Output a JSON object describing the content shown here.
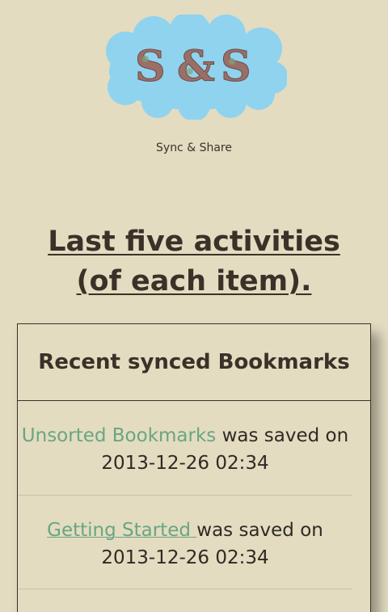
{
  "logo": {
    "text": "S&S",
    "colors": {
      "cloud": "#8fd3ef",
      "letters": "#9a6f68"
    }
  },
  "tagline": "Sync & Share",
  "heading": "Last five activities (of each item).",
  "panel": {
    "title": "Recent synced Bookmarks",
    "entries": [
      {
        "link": "Unsorted Bookmarks",
        "text": " was saved on",
        "date": "2013-12-26 02:34"
      },
      {
        "link": "Getting Started ",
        "text": "was saved on",
        "date": "2013-12-26 02:34"
      }
    ]
  },
  "colors": {
    "background": "#e3dcc1",
    "link": "#6aa583",
    "text": "#2f2a24"
  }
}
